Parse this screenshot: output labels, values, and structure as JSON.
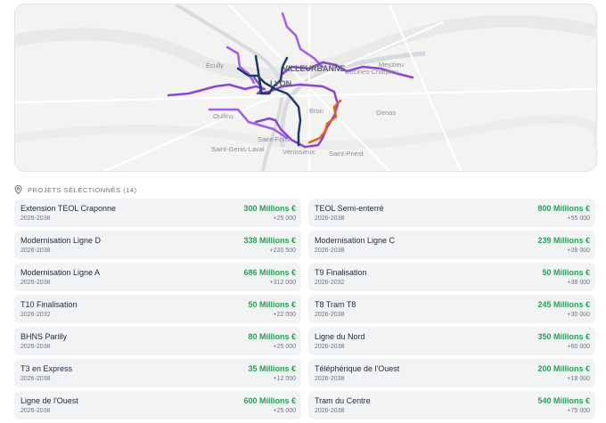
{
  "map": {
    "cities": {
      "villeurbanne": "VILLEURBANNE",
      "lyon": "LYON",
      "ecully": "Écully",
      "decines": "Décines-Charpieu",
      "meyzieu": "Meyzieu",
      "bron": "Bron",
      "genas": "Genas",
      "oullins": "Oullins",
      "saint_genis": "Saint-Genis-Laval",
      "saint_fons": "Saint-Fons",
      "venissieux": "Vénissieux",
      "saint_priest": "Saint-Priest"
    },
    "colors": {
      "purple": "#8b45d6",
      "light_purple": "#a35cf0",
      "navy": "#1e3a6a",
      "orange": "#e8620e"
    }
  },
  "section": {
    "title": "PROJETS SÉLECTIONNÉS (14)",
    "icon": "map-pin-icon"
  },
  "projects": [
    {
      "name": "Extension TEOL Craponne",
      "years": "2026-2038",
      "cost": "300 Millions €",
      "delta": "+25 000"
    },
    {
      "name": "TEOL Semi-enterré",
      "years": "2026-2038",
      "cost": "800 Millions €",
      "delta": "+55 000"
    },
    {
      "name": "Modernisation Ligne D",
      "years": "2026-2038",
      "cost": "338 Millions €",
      "delta": "+220 500"
    },
    {
      "name": "Modernisation Ligne C",
      "years": "2026-2038",
      "cost": "239 Millions €",
      "delta": "+28 000"
    },
    {
      "name": "Modernisation Ligne A",
      "years": "2026-2038",
      "cost": "686 Millions €",
      "delta": "+312 000"
    },
    {
      "name": "T9 Finalisation",
      "years": "2026-2032",
      "cost": "50 Millions €",
      "delta": "+38 000"
    },
    {
      "name": "T10 Finalisation",
      "years": "2026-2032",
      "cost": "50 Millions €",
      "delta": "+22 000"
    },
    {
      "name": "T8 Tram T8",
      "years": "2026-2038",
      "cost": "245 Millions €",
      "delta": "+30 000"
    },
    {
      "name": "BHNS Parilly",
      "years": "2026-2038",
      "cost": "80 Millions €",
      "delta": "+25 000"
    },
    {
      "name": "Ligne du Nord",
      "years": "2026-2038",
      "cost": "350 Millions €",
      "delta": "+60 000"
    },
    {
      "name": "T3 en Express",
      "years": "2026-2038",
      "cost": "35 Millions €",
      "delta": "+12 000"
    },
    {
      "name": "Téléphérique de l'Ouest",
      "years": "2026-2038",
      "cost": "200 Millions €",
      "delta": "+18 000"
    },
    {
      "name": "Ligne de l'Ouest",
      "years": "2026-2038",
      "cost": "600 Millions €",
      "delta": "+25 000"
    },
    {
      "name": "Tram du Centre",
      "years": "2026-2038",
      "cost": "540 Millions €",
      "delta": "+75 000"
    }
  ]
}
